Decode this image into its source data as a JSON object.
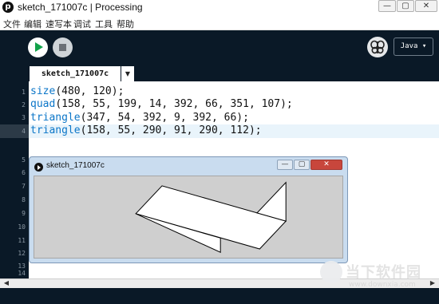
{
  "window": {
    "title": "sketch_171007c | Processing",
    "app_icon_glyph": "p",
    "controls": {
      "minimize": "—",
      "maximize": "▢",
      "close": "✕"
    }
  },
  "menu": [
    "文件",
    "编辑",
    "速写本",
    "调试",
    "工具",
    "帮助"
  ],
  "toolbar": {
    "run_icon": "play-icon",
    "stop_icon": "stop-icon",
    "debug_icon": "butterfly-icon",
    "mode_label": "Java ▾"
  },
  "tab": {
    "label": "sketch_171007c",
    "menu_glyph": "▼"
  },
  "editor": {
    "line_numbers": [
      "1",
      "2",
      "3",
      "4",
      "5",
      "6",
      "7",
      "8",
      "9",
      "10",
      "11",
      "12",
      "13",
      "14"
    ],
    "lines": [
      {
        "fn": "size",
        "args": "(480, 120);"
      },
      {
        "fn": "quad",
        "args": "(158, 55, 199, 14, 392, 66, 351, 107);"
      },
      {
        "fn": "triangle",
        "args": "(347, 54, 392, 9, 392, 66);"
      },
      {
        "fn": "triangle",
        "args": "(158, 55, 290, 91, 290, 112);"
      }
    ],
    "current_line": 4
  },
  "sketch_window": {
    "title": "sketch_171007c",
    "controls": {
      "minimize": "—",
      "maximize": "▢",
      "close": "✕"
    },
    "colors": {
      "background": "#cfcfcf",
      "fill": "#ffffff",
      "stroke": "#000000"
    }
  },
  "scrollbar": {
    "left_arrow": "◀",
    "right_arrow": "▶"
  },
  "watermark": {
    "brand": "当下软件园",
    "url": "www.downxia.com"
  },
  "colors": {
    "ide_dark": "#0a1927",
    "keyword_blue": "#0b76c8",
    "run_green": "#12a24a"
  }
}
